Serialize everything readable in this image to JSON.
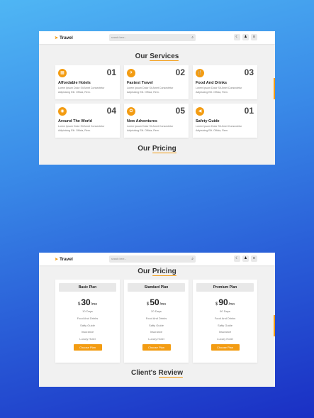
{
  "brand": {
    "name": "Travel",
    "logo_icon": "paper-plane-icon"
  },
  "search": {
    "placeholder": "search here..."
  },
  "nav_icons": [
    {
      "name": "moon-icon",
      "glyph": "☾"
    },
    {
      "name": "user-icon",
      "glyph": "♟"
    },
    {
      "name": "menu-icon",
      "glyph": "≡"
    }
  ],
  "services": {
    "title_plain": "Our ",
    "title_highlight": "Services",
    "cards": [
      {
        "num": "01",
        "title": "Affordable Hotels",
        "icon": "hotel-icon",
        "glyph": "▦",
        "desc": "Lorem Ipsum Dolor Sit Amet Consectetur Adipisicing Elit. Officia, Rem."
      },
      {
        "num": "02",
        "title": "Fastest Travel",
        "icon": "plane-icon",
        "glyph": "✈",
        "desc": "Lorem Ipsum Dolor Sit Amet Consectetur Adipisicing Elit. Officia, Rem."
      },
      {
        "num": "03",
        "title": "Food And Drinks",
        "icon": "utensils-icon",
        "glyph": "🍴",
        "desc": "Lorem Ipsum Dolor Sit Amet Consectetur Adipisicing Elit. Officia, Rem."
      },
      {
        "num": "04",
        "title": "Around The World",
        "icon": "globe-icon",
        "glyph": "◉",
        "desc": "Lorem Ipsum Dolor Sit Amet Consectetur Adipisicing Elit. Officia, Rem."
      },
      {
        "num": "05",
        "title": "New Adventures",
        "icon": "hiking-icon",
        "glyph": "✪",
        "desc": "Lorem Ipsum Dolor Sit Amet Consectetur Adipisicing Elit. Officia, Rem."
      },
      {
        "num": "01",
        "title": "Safety Guide",
        "icon": "bullhorn-icon",
        "glyph": "◀",
        "desc": "Lorem Ipsum Dolor Sit Amet Consectetur Adipisicing Elit. Officia, Rem."
      }
    ]
  },
  "pricing": {
    "title_plain": "Our ",
    "title_highlight": "Pricing",
    "plans": [
      {
        "name": "Basic Plan",
        "currency": "$",
        "amount": "30",
        "period": "/mo",
        "features": [
          "10 Days",
          "Food And Drinks",
          "Safty Guide",
          "Insurance",
          "Luxury Hotel"
        ],
        "button": "Choose Plan"
      },
      {
        "name": "Standard Plan",
        "currency": "$",
        "amount": "50",
        "period": "/mo",
        "features": [
          "20 Days",
          "Food And Drinks",
          "Safty Guide",
          "Insurance",
          "Luxury Hotel"
        ],
        "button": "Choose Plan"
      },
      {
        "name": "Premium Plan",
        "currency": "$",
        "amount": "90",
        "period": "/mo",
        "features": [
          "90 Days",
          "Food And Drinks",
          "Safty Guide",
          "Insurance",
          "Luxury Hotel"
        ],
        "button": "Choose Plan"
      }
    ]
  },
  "review": {
    "title_plain": "Client's ",
    "title_highlight": "Review"
  },
  "colors": {
    "accent": "#f39c12",
    "panel_bg": "#f1f1f1",
    "card_bg": "#ffffff"
  }
}
